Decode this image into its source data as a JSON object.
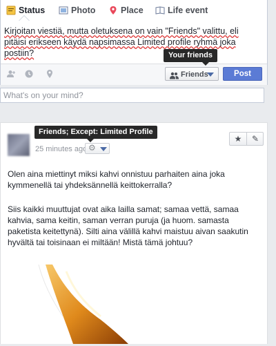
{
  "composer": {
    "tabs": [
      {
        "label": "Status",
        "icon": "status-icon",
        "active": true
      },
      {
        "label": "Photo",
        "icon": "photo-icon"
      },
      {
        "label": "Place",
        "icon": "place-icon"
      },
      {
        "label": "Life event",
        "icon": "life-event-icon"
      }
    ],
    "message_parts": [
      {
        "text": "Kirjoitan viestiä, mutta oletuksena on vain \"Friends\" valittu, eli pitäisi erikseen käydä napsimassa Limited profile ryhmä joka postiin?",
        "misspelled": false
      }
    ],
    "message": "Kirjoitan viestiä, mutta oletuksena on vain \"Friends\" valittu, eli pitäisi erikseen käydä napsimassa Limited profile ryhmä joka postiin?",
    "audience_label": "Friends",
    "audience_tooltip": "Your friends",
    "post_label": "Post"
  },
  "mind": {
    "placeholder": "What's on your mind?"
  },
  "story": {
    "timestamp": "25 minutes ago",
    "privacy_tooltip": "Friends; Except: Limited Profile",
    "paragraph1": "Olen aina miettinyt miksi kahvi onnistuu parhaiten aina joka kymmenellä tai yhdeksännellä keittokerralla?",
    "paragraph2": "Siis kaikki muuttujat ovat aika lailla samat; samaa vettä, samaa kahvia, sama keitin, saman verran puruja (ja huom. samasta paketista keitettynä). Silti aina välillä kahvi maistuu aivan saakutin hyvältä tai toisinaan ei miltään! Mistä tämä johtuu?"
  },
  "colors": {
    "post_button": "#5b7bd5",
    "tooltip": "#282828",
    "link_blue": "#4b6aa5"
  }
}
